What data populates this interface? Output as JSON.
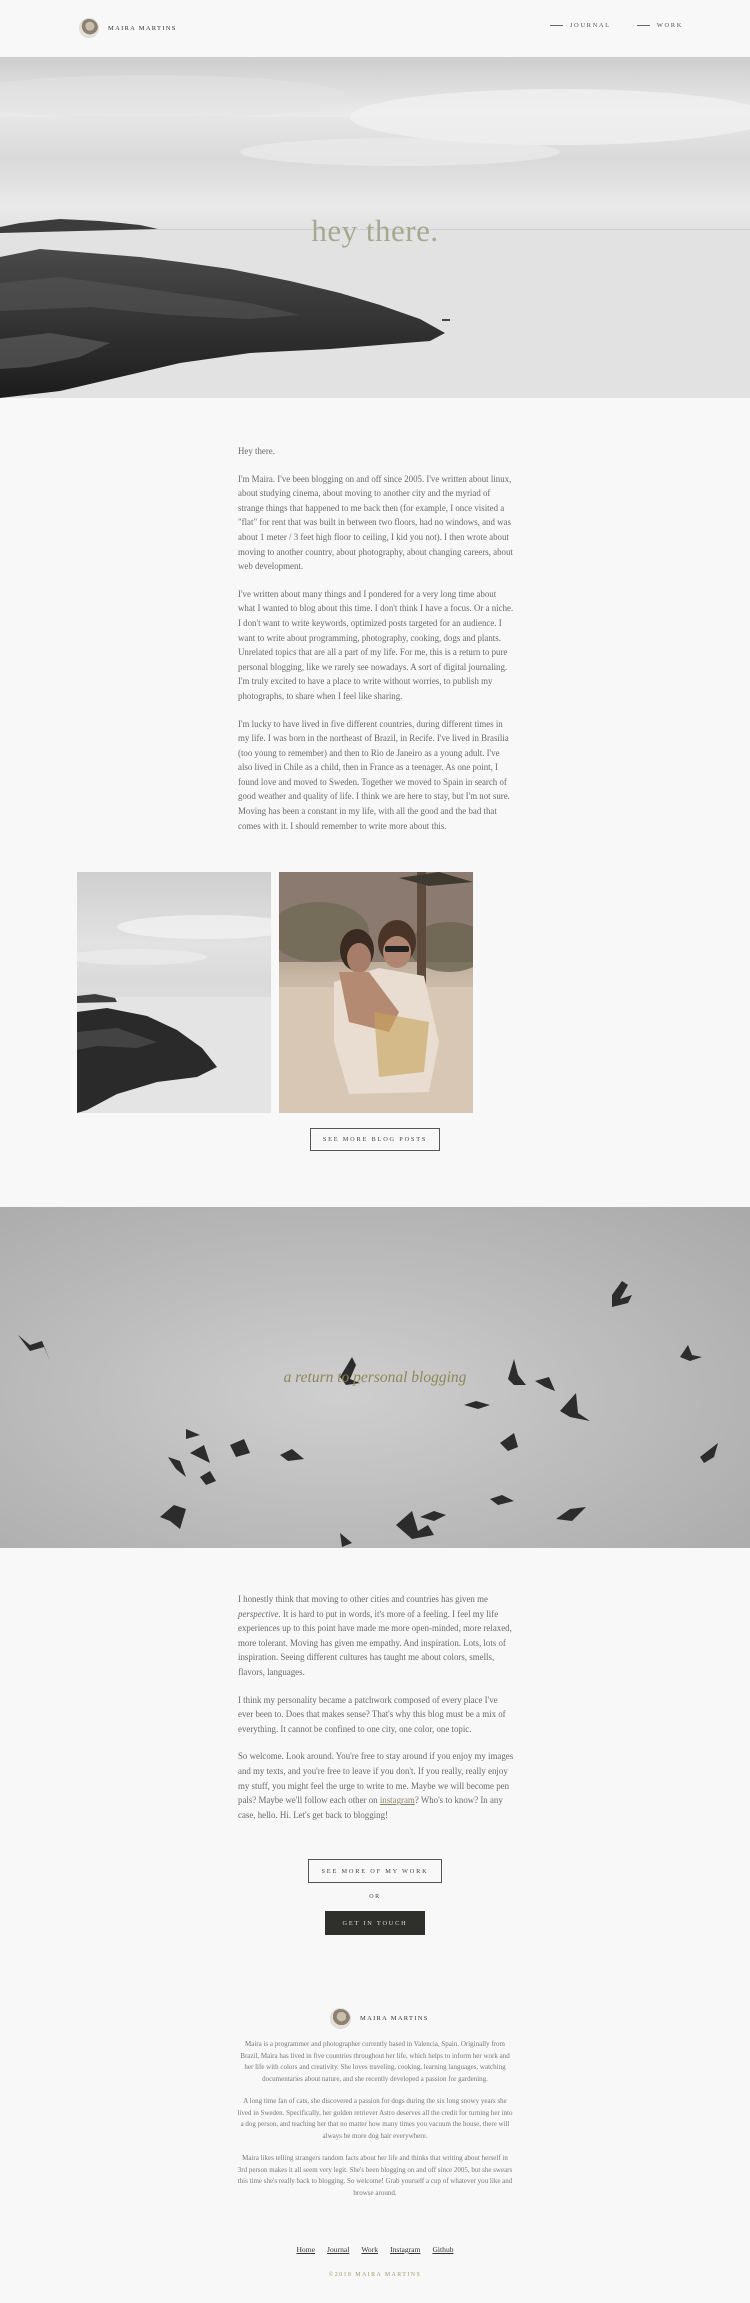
{
  "header": {
    "site_name": "MAIRA MARTINS",
    "nav": [
      {
        "label": "JOURNAL"
      },
      {
        "label": "WORK"
      }
    ]
  },
  "hero": {
    "title": "hey there."
  },
  "intro": {
    "greeting": "Hey there.",
    "p1": "I'm Maira. I've been blogging on and off since 2005. I've written about linux, about studying cinema, about moving to another city and the myriad of strange things that happened to me back then (for example, I once visited a \"flat\" for rent that was built in between two floors, had no windows, and was about 1 meter / 3 feet high floor to ceiling, I kid you not). I then wrote about moving to another country, about photography, about changing careers, about web development.",
    "p2": "I've written about many things and I pondered for a very long time about what I wanted to blog about this time. I don't think I have a focus. Or a niche. I don't want to write keywords, optimized posts targeted for an audience. I want to write about programming, photography, cooking, dogs and plants. Unrelated topics that are all a part of my life. For me, this is a return to pure personal blogging, like we rarely see nowadays. A sort of digital journaling. I'm truly excited to have a place to write without worries, to publish my photographs, to share when I feel like sharing.",
    "p3": "I'm lucky to have lived in five different countries, during different times in my life. I was born in the northeast of Brazil, in Recife. I've lived in Brasília (too young to remember) and then to Rio de Janeiro as a young adult. I've also lived in Chile as a child, then in France as a teenager. As one point, I found love and moved to Sweden. Together we moved to Spain in search of good weather and quality of life. I think we are here to stay, but I'm not sure. Moving has been a constant in my life, with all the good and the bad that comes with it. I should remember to write more about this."
  },
  "buttons": {
    "more_posts": "SEE MORE BLOG POSTS",
    "more_work": "SEE MORE OF MY WORK",
    "or": "OR",
    "contact": "GET IN TOUCH"
  },
  "birds": {
    "title": "a return to personal blogging"
  },
  "outro": {
    "p1_start": "I honestly think that moving to other cities and countries has given me ",
    "p1_em": "perspective",
    "p1_end": ". It is hard to put in words, it's more of a feeling. I feel my life experiences up to this point have made me more open-minded, more relaxed, more tolerant. Moving has given me empathy. And inspiration. Lots, lots of inspiration. Seeing different cultures has taught me about colors, smells, flavors, languages.",
    "p2": "I think my personality became a patchwork composed of every place I've ever been to. Does that makes sense? That's why this blog must be a mix of everything. It cannot be confined to one city, one color, one topic.",
    "p3_start": "So welcome. Look around. You're free to stay around if you enjoy my images and my texts, and you're free to leave if you don't. If you really, really enjoy my stuff, you might feel the urge to write to me. Maybe we will become pen pals? Maybe we'll follow each other on ",
    "p3_link": "instagram",
    "p3_end": "? Who's to know? In any case, hello. Hi. Let's get back to blogging!"
  },
  "footer": {
    "site_name": "MAIRA MARTINS",
    "p1": "Maira is a programmer and photographer currently based in Valencia, Spain. Originally from Brazil, Maira has lived in five countries throughout her life, which helps to inform her work and her life with colors and creativity. She loves traveling, cooking, learning languages, watching documentaries about nature, and she recently developed a passion for gardening.",
    "p2": "A long time fan of cats, she discovered a passion for dogs during the six long snowy years she lived in Sweden. Specifically, her golden retriever Astro deserves all the credit for turning her into a dog person, and teaching her that no matter how many times you vacuum the house, there will always be more dog hair everywhere.",
    "p3": "Maira likes telling strangers random facts about her life and thinks that writing about herself in 3rd person makes it all seem very legit. She's been blogging on and off since 2005, but she swears this time she's really back to blogging. So welcome! Grab yourself a cup of whatever you like and browse around.",
    "links": [
      "Home",
      "Journal",
      "Work",
      "Instagram",
      "Github"
    ],
    "copyright": "©2018 MAIRA MARTINS"
  },
  "colors": {
    "accent": "#a39b6e",
    "hero_title": "#a7a891",
    "dark_button": "#2f2f2c",
    "background": "#f8f8f8"
  }
}
